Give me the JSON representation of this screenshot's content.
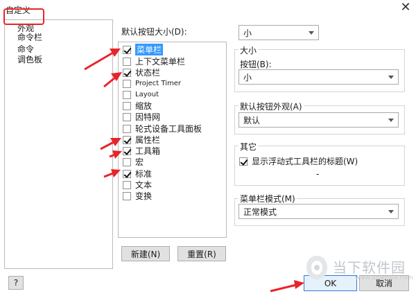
{
  "window": {
    "title": "自定义",
    "close_glyph": "✕"
  },
  "categories": [
    {
      "label": "外观"
    },
    {
      "label": "命令栏"
    },
    {
      "label": "命令"
    },
    {
      "label": "调色板"
    }
  ],
  "list_section": {
    "label": "默认按钮大小(D):"
  },
  "commands": [
    {
      "label": "菜单栏",
      "checked": true,
      "selected": true
    },
    {
      "label": "上下文菜单栏",
      "checked": false
    },
    {
      "label": "状态栏",
      "checked": true
    },
    {
      "label": "Project Timer",
      "checked": false
    },
    {
      "label": "Layout",
      "checked": false
    },
    {
      "label": "缩放",
      "checked": false
    },
    {
      "label": "因特网",
      "checked": false
    },
    {
      "label": "轮式设备工具面板",
      "checked": false
    },
    {
      "label": "属性栏",
      "checked": true
    },
    {
      "label": "工具箱",
      "checked": true
    },
    {
      "label": "宏",
      "checked": false
    },
    {
      "label": "标准",
      "checked": true
    },
    {
      "label": "文本",
      "checked": false
    },
    {
      "label": "变换",
      "checked": false
    }
  ],
  "list_buttons": {
    "new": "新建(N)",
    "reset": "重置(R)"
  },
  "right_panel": {
    "default_size_value": "小",
    "size_group": {
      "title": "大小",
      "button_label": "按钮(B):",
      "button_value": "小"
    },
    "appearance_group": {
      "title": "默认按钮外观(A)",
      "value": "默认"
    },
    "other_group": {
      "title": "其它",
      "show_title_label": "显示浮动式工具栏的标题(W)",
      "show_title_checked": true,
      "dash": "-"
    },
    "menubar_group": {
      "title": "菜单栏模式(M)",
      "value": "正常模式"
    }
  },
  "footer": {
    "help": "?",
    "ok": "OK",
    "cancel": "取消"
  },
  "watermark": {
    "text": "当下软件园",
    "url": "www.downxia.com"
  },
  "colors": {
    "highlight_red": "#e8242a",
    "selection_blue": "#3399ff",
    "arrow_red": "#e8242a"
  }
}
